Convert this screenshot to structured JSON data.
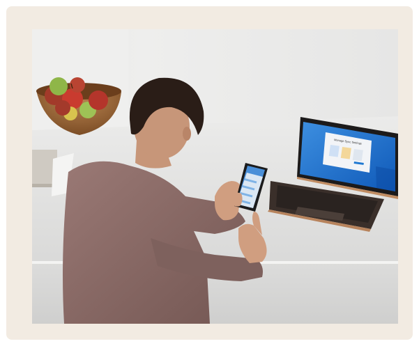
{
  "photo": {
    "alt": "",
    "laptop_screen_title": "Manage Sync Settings"
  },
  "colors": {
    "card_background": "#f2ebe2",
    "wall": "#e9e9e8",
    "counter": "#e4e4e2",
    "sweater": "#8a6a66",
    "laptop_screen_blue": "#1f78d1"
  }
}
